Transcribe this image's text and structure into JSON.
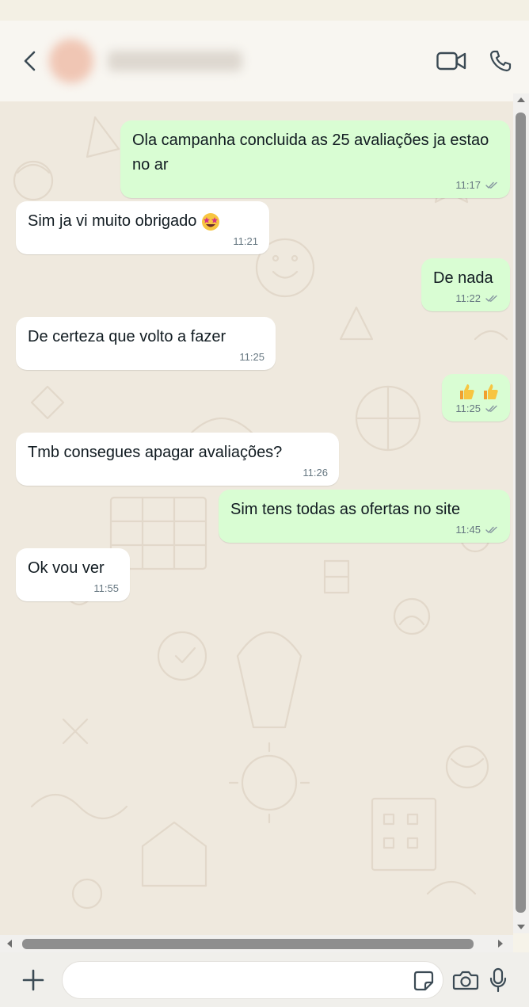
{
  "header": {
    "back_icon": "chevron-left-icon",
    "contact_name": "",
    "video_icon": "video-camera-icon",
    "call_icon": "phone-icon"
  },
  "colors": {
    "incoming_bubble": "#ffffff",
    "outgoing_bubble": "#d9fdd3",
    "wallpaper": "#efe9de",
    "timestamp": "#667781"
  },
  "messages": [
    {
      "direction": "out",
      "text": "Ola campanha concluida as 25 avaliações ja estao no ar",
      "time": "11:17",
      "status": "read-ticks"
    },
    {
      "direction": "in",
      "text": "Sim ja vi muito obrigado",
      "emoji": "star-struck-emoji",
      "time": "11:21"
    },
    {
      "direction": "out",
      "text": "De nada",
      "time": "11:22",
      "status": "read-ticks"
    },
    {
      "direction": "in",
      "text": "De certeza que volto a fazer",
      "time": "11:25"
    },
    {
      "direction": "out",
      "text": "",
      "emoji": "thumbs-up-emoji x2",
      "time": "11:25",
      "status": "read-ticks"
    },
    {
      "direction": "in",
      "text": "Tmb consegues apagar avaliações?",
      "time": "11:26"
    },
    {
      "direction": "out",
      "text": "Sim tens todas as ofertas no site",
      "time": "11:45",
      "status": "read-ticks"
    },
    {
      "direction": "in",
      "text": "Ok vou ver",
      "time": "11:55"
    }
  ],
  "composer": {
    "placeholder": "",
    "add_icon": "plus-icon",
    "sticker_icon": "sticker-icon",
    "camera_icon": "camera-icon",
    "mic_icon": "microphone-icon"
  }
}
